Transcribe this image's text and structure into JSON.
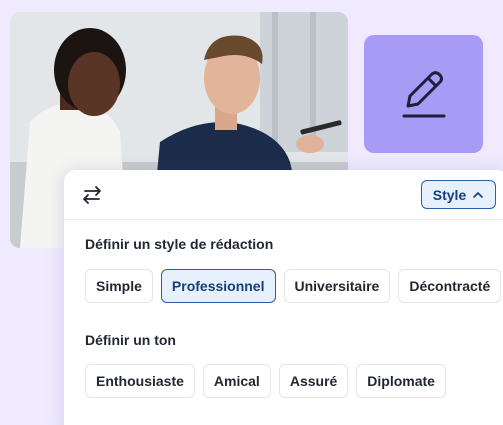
{
  "photo": {
    "icon": "photo-two-people"
  },
  "pen_tile": {
    "icon": "pencil-icon",
    "color": "#a79bf6"
  },
  "panel": {
    "swap_icon": "swap-arrows-icon",
    "style_button": {
      "label": "Style",
      "icon": "chevron-up-icon"
    },
    "style_section": {
      "title": "Définir un style de rédaction",
      "options": [
        "Simple",
        "Professionnel",
        "Universitaire",
        "Décontracté"
      ],
      "selected": "Professionnel"
    },
    "tone_section": {
      "title": "Définir un ton",
      "options": [
        "Enthousiaste",
        "Amical",
        "Assuré",
        "Diplomate"
      ]
    }
  },
  "colors": {
    "accent": "#2d5ea8",
    "accent_bg": "#e6f1fd",
    "background": "#efeafd"
  }
}
